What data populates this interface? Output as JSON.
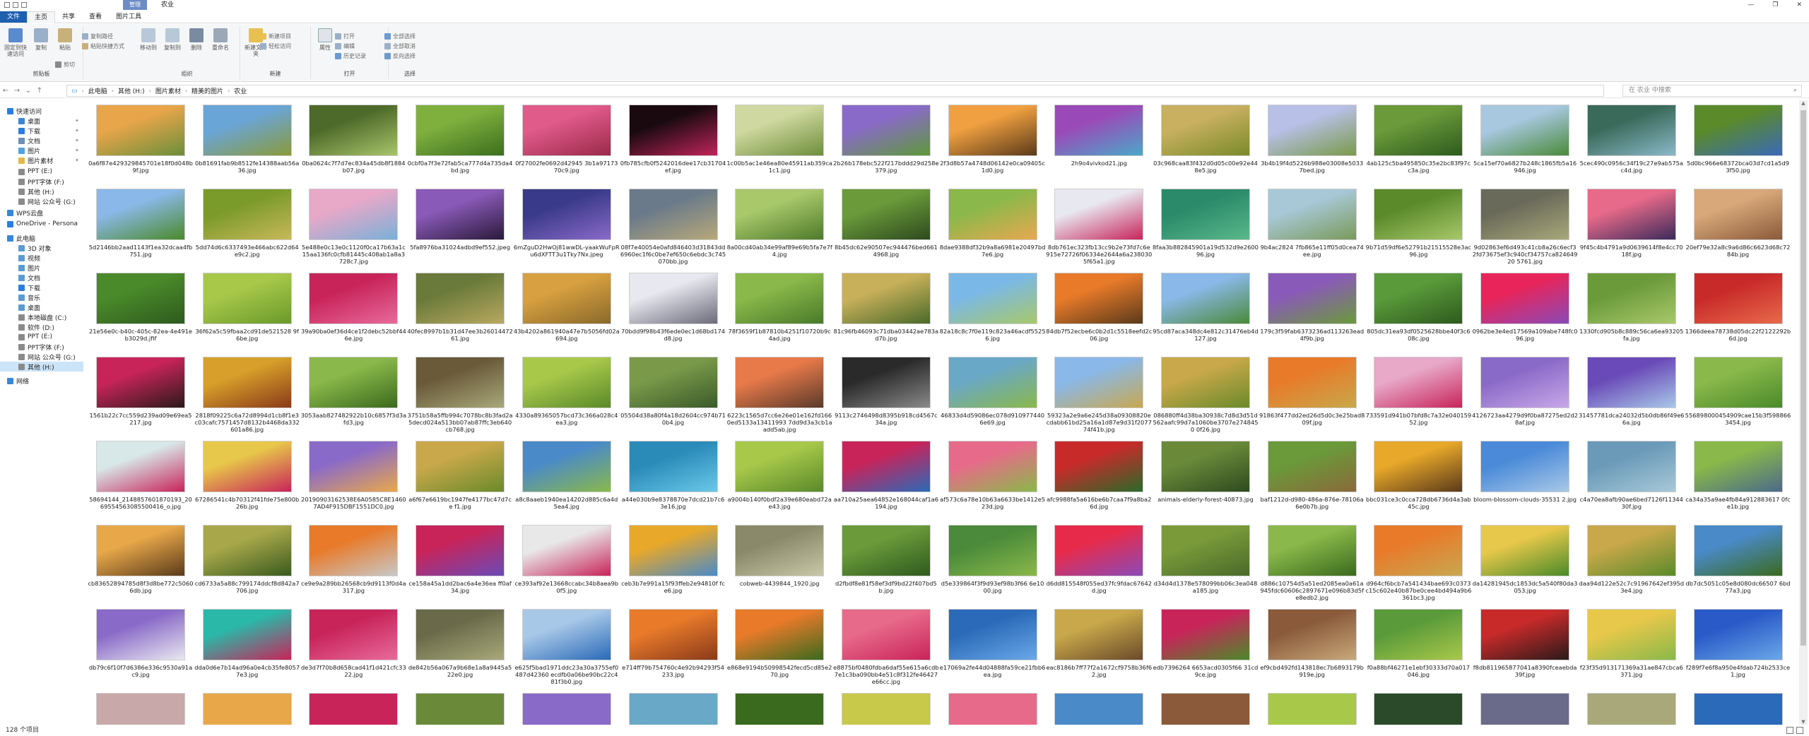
{
  "window": {
    "title": "农业",
    "context_tab": "管理",
    "controls": [
      "—",
      "❐",
      "✕"
    ]
  },
  "ribbon_tabs": [
    {
      "label": "文件",
      "kind": "file"
    },
    {
      "label": "主页",
      "kind": "active"
    },
    {
      "label": "共享",
      "kind": "normal"
    },
    {
      "label": "查看",
      "kind": "normal"
    },
    {
      "label": "图片工具",
      "kind": "normal"
    }
  ],
  "ribbon": {
    "clipboard": {
      "label": "剪贴板",
      "pin": "固定到快速访问",
      "copy": "复制",
      "paste": "粘贴",
      "copy_path": "复制路径",
      "paste_shortcut": "粘贴快捷方式",
      "cut": "剪切"
    },
    "organize": {
      "label": "组织",
      "move_to": "移动到",
      "copy_to": "复制到",
      "delete": "删除",
      "rename": "重命名"
    },
    "new": {
      "label": "新建",
      "new_folder": "新建文件夹",
      "new_item": "新建项目",
      "easy_access": "轻松访问"
    },
    "open": {
      "label": "打开",
      "properties": "属性",
      "open": "打开",
      "edit": "编辑",
      "history": "历史记录"
    },
    "select": {
      "label": "选择",
      "select_all": "全部选择",
      "select_none": "全部取消",
      "invert": "反向选择"
    }
  },
  "address": {
    "crumbs": [
      "此电脑",
      "其他 (H:)",
      "图片素材",
      "精美的图片",
      "农业"
    ],
    "search_placeholder": "在 农业 中搜索"
  },
  "nav": [
    {
      "label": "快速访问",
      "indent": 0,
      "color": "#2b7de1"
    },
    {
      "label": "桌面",
      "indent": 1,
      "color": "#3a86d6",
      "pin": true
    },
    {
      "label": "下载",
      "indent": 1,
      "color": "#2b7de1",
      "pin": true
    },
    {
      "label": "文档",
      "indent": 1,
      "color": "#6d8fb8",
      "pin": true
    },
    {
      "label": "图片",
      "indent": 1,
      "color": "#4ea3e0",
      "pin": true
    },
    {
      "label": "图片素材",
      "indent": 1,
      "color": "#e6b84a",
      "pin": true
    },
    {
      "label": "PPT (E:)",
      "indent": 1,
      "color": "#8a8a8a"
    },
    {
      "label": "PPT字体 (F:)",
      "indent": 1,
      "color": "#8a8a8a"
    },
    {
      "label": "其他 (H:)",
      "indent": 1,
      "color": "#8a8a8a"
    },
    {
      "label": "网站 公众号 (G:)",
      "indent": 1,
      "color": "#8a8a8a"
    },
    {
      "label": "WPS云盘",
      "indent": 0,
      "color": "#3a86d6"
    },
    {
      "label": "OneDrive - Persona",
      "indent": 0,
      "color": "#2b7de1"
    },
    {
      "label": "此电脑",
      "indent": 0,
      "color": "#3a86d6"
    },
    {
      "label": "3D 对象",
      "indent": 1,
      "color": "#5b9bd5"
    },
    {
      "label": "视频",
      "indent": 1,
      "color": "#5b9bd5"
    },
    {
      "label": "图片",
      "indent": 1,
      "color": "#5b9bd5"
    },
    {
      "label": "文档",
      "indent": 1,
      "color": "#5b9bd5"
    },
    {
      "label": "下载",
      "indent": 1,
      "color": "#2b7de1"
    },
    {
      "label": "音乐",
      "indent": 1,
      "color": "#5b9bd5"
    },
    {
      "label": "桌面",
      "indent": 1,
      "color": "#5b9bd5"
    },
    {
      "label": "本地磁盘 (C:)",
      "indent": 1,
      "color": "#8a8a8a"
    },
    {
      "label": "软件 (D:)",
      "indent": 1,
      "color": "#8a8a8a"
    },
    {
      "label": "PPT (E:)",
      "indent": 1,
      "color": "#8a8a8a"
    },
    {
      "label": "PPT字体 (F:)",
      "indent": 1,
      "color": "#8a8a8a"
    },
    {
      "label": "网站 公众号 (G:)",
      "indent": 1,
      "color": "#8a8a8a"
    },
    {
      "label": "其他 (H:)",
      "indent": 1,
      "color": "#8a8a8a",
      "selected": true
    },
    {
      "label": "网络",
      "indent": 0,
      "color": "#3a86d6"
    }
  ],
  "files": [
    {
      "name": "0a6f87e429329845701e18f0d048b9f.jpg",
      "colors": [
        "#e9a54a",
        "#6a8f3a"
      ]
    },
    {
      "name": "0b81691fab9b8512fe14388aab56a36.jpg",
      "colors": [
        "#6aa5d8",
        "#8a9a3a"
      ]
    },
    {
      "name": "0ba0624c7f7d7ec834a45db8f1884b07.jpg",
      "colors": [
        "#4e6a2a",
        "#a7c46a"
      ]
    },
    {
      "name": "0cbf0a7f3e72fab5ca777d4a735da4bd.jpg",
      "colors": [
        "#7fb03e",
        "#3d6e1e"
      ]
    },
    {
      "name": "0f27002fe0692d42945 3b1a9717370c9.jpg",
      "colors": [
        "#e05a8a",
        "#9a2a4a"
      ]
    },
    {
      "name": "0fb785cfb0f5242016dee17cb31704ef.jpg",
      "colors": [
        "#1a0a10",
        "#c0245a"
      ]
    },
    {
      "name": "1c00b5ac1e46ea80e45911ab359ca1c1.jpg",
      "colors": [
        "#cfd8a0",
        "#6e8e3a"
      ]
    },
    {
      "name": "2b26b178ebc522f217bddd29d258e379.jpg",
      "colors": [
        "#8a6ac8",
        "#5e9a3a"
      ]
    },
    {
      "name": "2f3d8b57a4748d06142e0ca09405c1d0.jpg",
      "colors": [
        "#f0a040",
        "#5a3a1a"
      ]
    },
    {
      "name": "2h9o4vivkod21.jpg",
      "colors": [
        "#9a4ab8",
        "#4aa8c8"
      ]
    },
    {
      "name": "03c968caa83f432d0d05c00e92e448e5.jpg",
      "colors": [
        "#c8b060",
        "#7a8a2a"
      ]
    },
    {
      "name": "3b4b19f4d5226b988e03008e50337bed.jpg",
      "colors": [
        "#b8c0e8",
        "#7a9a4a"
      ]
    },
    {
      "name": "4ab125c5ba495850c35e2bc83f97cc3a.jpg",
      "colors": [
        "#6a9a3a",
        "#2e5a1e"
      ]
    },
    {
      "name": "5ca15ef70a6827b248c1865fb5a16946.jpg",
      "colors": [
        "#a8c8e0",
        "#4a8a3a"
      ]
    },
    {
      "name": "5cec490c0956c34f19c27e9ab575ac4d.jpg",
      "colors": [
        "#3a6a5a",
        "#8ab8c8"
      ]
    },
    {
      "name": "5d0bc966e68372bca03d7cd1a5d93f50.jpg",
      "colors": [
        "#5a8a2a",
        "#3a6ab8"
      ]
    },
    {
      "name": "5d2146bb2aad1143f1ea32dcaa4fb751.jpg",
      "colors": [
        "#8ab8e8",
        "#4a8a2a"
      ]
    },
    {
      "name": "5dd74d6c6337493e466abc622d64e9c2.jpg",
      "colors": [
        "#7a9a2a",
        "#c8b85a"
      ]
    },
    {
      "name": "5e488e0c13e0c1120f0ca17b63a1c15aa136fc0cfb81445c408ab1a8a3728c7.jpg",
      "colors": [
        "#e8a8c8",
        "#7ab0d8"
      ]
    },
    {
      "name": "5fa8976ba31024adbd9ef552.jpeg",
      "colors": [
        "#8a5ab8",
        "#2a1a3a"
      ]
    },
    {
      "name": "6mZguD2HwOj81wwDL-yaakWuFpRu6dXFTT3u1Tky7Nx.jpeg",
      "colors": [
        "#3a3a8a",
        "#8a6ac8"
      ]
    },
    {
      "name": "08f7e40054e0afd846403d31843dd6960ec1f6c0be7ef650c6ebdc3c745070bb.jpg",
      "colors": [
        "#6a7a8a",
        "#b8a87a"
      ]
    },
    {
      "name": "8a00cd40ab34e99af89e69b5fa7e7f4.jpg",
      "colors": [
        "#a8c86a",
        "#4e7a2a"
      ]
    },
    {
      "name": "8b45dc62e90507ec944476bed6614968.jpg",
      "colors": [
        "#6a9a3a",
        "#2e4a1e"
      ]
    },
    {
      "name": "8dae9388df32b9a8a6981e20497bd7e6.jpg",
      "colors": [
        "#8ab84a",
        "#e8a850"
      ]
    },
    {
      "name": "8db761ec323fb13cc9b2e73fd7c6e915e72726f06334e2644a6a2380305f65a1.jpg",
      "colors": [
        "#e8e8f0",
        "#c8245a"
      ]
    },
    {
      "name": "8faa3b882845901a19d532d9e260096.jpg",
      "colors": [
        "#2a8a6a",
        "#5ab88a"
      ]
    },
    {
      "name": "9b4ac2824 7fb865e11ff05d0cea74ee.jpg",
      "colors": [
        "#a8c8d8",
        "#7a9a5a"
      ]
    },
    {
      "name": "9b71d59df6e52791b21515528e3ac96.jpg",
      "colors": [
        "#5a8a2a",
        "#a8c86a"
      ]
    },
    {
      "name": "9d02863ef6d493c41cb8a26c6ecf32fd73675ef3c940cf34757ca82464920 5761.jpg",
      "colors": [
        "#6a6a5a",
        "#a8a87a"
      ]
    },
    {
      "name": "9f45c4b4791a9d0639614f8e4cc7018f.jpg",
      "colors": [
        "#e86a8a",
        "#3a2a5a"
      ]
    },
    {
      "name": "20ef79e32a8c9a6d86c6623d68c7284b.jpg",
      "colors": [
        "#d8a87a",
        "#8a5a3a"
      ]
    },
    {
      "name": "21e56e0c-b40c-405c-82ea-4e491eb3029d.jfif",
      "colors": [
        "#4a8a2a",
        "#2e5a1e"
      ]
    },
    {
      "name": "36f62a5c59fbaa2cd91de521528 9f6be.jpg",
      "colors": [
        "#a8c84a",
        "#6a9a2a"
      ]
    },
    {
      "name": "39a90ba0ef36d4ce1f2debc52bbf446e.jpg",
      "colors": [
        "#c8245a",
        "#e86a9a"
      ]
    },
    {
      "name": "40fec8997b1b31d47ee3b2601447261.jpg",
      "colors": [
        "#6a7a3a",
        "#b8a860"
      ]
    },
    {
      "name": "43b4202a861940a47e7b5056fd02a694.jpg",
      "colors": [
        "#d8a040",
        "#8a6a2a"
      ]
    },
    {
      "name": "70bdd9f98b43f6ede0ec1d68bd174d8.jpg",
      "colors": [
        "#e8e8f0",
        "#6a6a7a"
      ]
    },
    {
      "name": "78f3659f1b87810b4251f10720b9c4ad.jpg",
      "colors": [
        "#8ab84a",
        "#4a7a2a"
      ]
    },
    {
      "name": "81c96fb46093c71dba03442ae783ad7b.jpg",
      "colors": [
        "#c8b05a",
        "#4a6a2a"
      ]
    },
    {
      "name": "82a18c8c7f0e119c823a46acdf55256.jpg",
      "colors": [
        "#7ab8e8",
        "#a8c86a"
      ]
    },
    {
      "name": "84db7f52ecbe6c0b2d1c5518eefd2c06.jpg",
      "colors": [
        "#e87a2a",
        "#5a3a1a"
      ]
    },
    {
      "name": "95cd87aca348dc4e812c31476eb4d127.jpg",
      "colors": [
        "#8ab8e8",
        "#4a8a3a"
      ]
    },
    {
      "name": "179c3f59fab6373236ad113263ead4f9b.jpg",
      "colors": [
        "#8a5ab8",
        "#6a9a3a"
      ]
    },
    {
      "name": "805dc31ea93df0525628bbe40f3c608c.jpg",
      "colors": [
        "#5a9a3a",
        "#2e5a1e"
      ]
    },
    {
      "name": "0962be3e4ed17569a109abe748fc096.jpg",
      "colors": [
        "#e8245a",
        "#8a4ab8"
      ]
    },
    {
      "name": "1330fcd905b8c889c56ca6ea93205fa.jpg",
      "colors": [
        "#6a9a3a",
        "#a8c86a"
      ]
    },
    {
      "name": "1366deea78738d05dc22f2122292b6d.jpg",
      "colors": [
        "#c82a2a",
        "#e86a4a"
      ]
    },
    {
      "name": "1561b22c7cc559d239ad09e69ea5217.jpg",
      "colors": [
        "#c8245a",
        "#2a1a1a"
      ]
    },
    {
      "name": "2818f09225c6a72d8994d1cb8f1e3c03cafc7571457d8132b4468da332601a86.jpg",
      "colors": [
        "#d8a02a",
        "#8a3a1a"
      ]
    },
    {
      "name": "3053aab827482922b10c6857f3d3afd3.jpg",
      "colors": [
        "#8ab84a",
        "#3a6a1e"
      ]
    },
    {
      "name": "3751b58a5ffb994c7078bc8b3fad2a5decd024a513bb07ab87ffc3eb640cb768.jpg",
      "colors": [
        "#6a5a3a",
        "#a8a87a"
      ]
    },
    {
      "name": "4330a89365057bcd73c366a028c4ea3.jpg",
      "colors": [
        "#a8c84a",
        "#5a8a2a"
      ]
    },
    {
      "name": "05504d38a80f4a18d2604cc974b710b4.jpg",
      "colors": [
        "#7a9a4a",
        "#3a5a2a"
      ]
    },
    {
      "name": "6223c1565d7cc6e26e01e162fd1660ed5133a13411993 7dd9d3a3cb1aadd5ab.jpg",
      "colors": [
        "#e87a4a",
        "#5a3a2a"
      ]
    },
    {
      "name": "9113c2746498d8395b918cd4567c34a.jpg",
      "colors": [
        "#2a2a2a",
        "#8a8a8a"
      ]
    },
    {
      "name": "46833d4d59086ec078d910977440 6e69.jpg",
      "colors": [
        "#6aa8c8",
        "#8ab84a"
      ]
    },
    {
      "name": "59323a2e9a6e245d38a09308820ecdabb61bd25a16a1d87e9d31f207774f41b.jpg",
      "colors": [
        "#8ab8e8",
        "#c8a850"
      ]
    },
    {
      "name": "086880ff4d38ba30938c7d8d3d51d562aafc99d7a1060be3707e2748450 0f26.jpg",
      "colors": [
        "#c8a84a",
        "#6a8a2a"
      ]
    },
    {
      "name": "91863f477dd2ed26d5d0c3e25bad809f.jpg",
      "colors": [
        "#e87a2a",
        "#c8a84a"
      ]
    },
    {
      "name": "733591d941b07bfd8c7a32e04015952.jpg",
      "colors": [
        "#e8a8c8",
        "#c8245a"
      ]
    },
    {
      "name": "4126723aa4279d9f0ba87275ed2d28af.jpg",
      "colors": [
        "#8a6ac8",
        "#c8a8e8"
      ]
    },
    {
      "name": "31457781dca24032d5b0db86f49e66a.jpg",
      "colors": [
        "#6a4ab8",
        "#a8c8e8"
      ]
    },
    {
      "name": "556898000454909cae15b3f5988663454.jpg",
      "colors": [
        "#8ab84a",
        "#4a8a2a"
      ]
    },
    {
      "name": "58694144_2148857601870193_2069554563085500416_o.jpg",
      "colors": [
        "#d8e8e8",
        "#c8245a"
      ]
    },
    {
      "name": "67286541c4b70312f41fde75e800b26b.jpg",
      "colors": [
        "#e8c84a",
        "#c8245a"
      ]
    },
    {
      "name": "20190903162538E6A0585C8E14607AD4F915DBF1551DC0.jpg",
      "colors": [
        "#8a6ac8",
        "#e8a84a"
      ]
    },
    {
      "name": "a6f67e6619bc1947fe4177bc47d7ce f1.jpg",
      "colors": [
        "#c8a84a",
        "#6a8a2a"
      ]
    },
    {
      "name": "a8c8aaeb1940ea14202d885c6a4d5ea4.jpg",
      "colors": [
        "#4a8ac8",
        "#8ab84a"
      ]
    },
    {
      "name": "a44e030b9e8378870e7dcd21b7c63e16.jpg",
      "colors": [
        "#2a8ab8",
        "#6ac8e8"
      ]
    },
    {
      "name": "a9004b140f0bdf2a39e680eabd72ae43.jpg",
      "colors": [
        "#a8c84a",
        "#5a8a2a"
      ]
    },
    {
      "name": "aa710a25aea64852e168044caf1a6194.jpg",
      "colors": [
        "#c8245a",
        "#2a6ab8"
      ]
    },
    {
      "name": "af573c6a78e10b63a6633be1412e5 23d.jpg",
      "colors": [
        "#e86a8a",
        "#8ab84a"
      ]
    },
    {
      "name": "afc9988fa5a616be6b7caa7f9a8ba26d.jpg",
      "colors": [
        "#c82a2a",
        "#2a6a2a"
      ]
    },
    {
      "name": "animals-elderly-forest-40873.jpg",
      "colors": [
        "#6a8a3a",
        "#2e4a1e"
      ]
    },
    {
      "name": "baf1212d-d980-486a-876e-78106a6e0b7b.jpg",
      "colors": [
        "#6a9a3a",
        "#8a6a3a"
      ]
    },
    {
      "name": "bbc031ce3c0cca728db6736d4a3ab45c.jpg",
      "colors": [
        "#e8a82a",
        "#5a3a1a"
      ]
    },
    {
      "name": "bloom-blossom-clouds-35531 2.jpg",
      "colors": [
        "#4a8ad8",
        "#a8c8e8"
      ]
    },
    {
      "name": "c4a70ea8afb90ae6bed7126f1134430f.jpg",
      "colors": [
        "#6a9ab8",
        "#a8c8d8"
      ]
    },
    {
      "name": "ca34a35a9ae4fb84a912883617 0fce1b.jpg",
      "colors": [
        "#8ab84a",
        "#4a6a8a"
      ]
    },
    {
      "name": "cb83652894785d8f3d8be772c50606db.jpg",
      "colors": [
        "#e8a84a",
        "#5a3a1a"
      ]
    },
    {
      "name": "cd6733a5a88c799174ddcf8d842a7706.jpg",
      "colors": [
        "#a8a84a",
        "#3a5a1e"
      ]
    },
    {
      "name": "ce9e9a289bb26568cb9d9113f0d4a317.jpg",
      "colors": [
        "#e87a2a",
        "#c8c8c8"
      ]
    },
    {
      "name": "ce158a45a1dd2bac6a4e36ea ff0af34.jpg",
      "colors": [
        "#c8245a",
        "#6a4ab8"
      ]
    },
    {
      "name": "ce393af92e13668ccabc34b8aea9b0f5.jpg",
      "colors": [
        "#e8e8e8",
        "#c8245a"
      ]
    },
    {
      "name": "ceb3b7e991a15f93ffeb2e94810f fce6.jpg",
      "colors": [
        "#e8a82a",
        "#4a8ac8"
      ]
    },
    {
      "name": "cobweb-4439844_1920.jpg",
      "colors": [
        "#8a8a6a",
        "#c8c8a8"
      ]
    },
    {
      "name": "d2fbdf8e81f58ef3df9bd22f407bd5b.jpg",
      "colors": [
        "#6a9a3a",
        "#2e5a1e"
      ]
    },
    {
      "name": "d5e339864f3f9d93ef98b3f66 6e1000.jpg",
      "colors": [
        "#4a8a3a",
        "#8ab84a"
      ]
    },
    {
      "name": "d6dd815548f055ed37fc9fdac67642d.jpg",
      "colors": [
        "#e82a4a",
        "#8a4ab8"
      ]
    },
    {
      "name": "d34d4d1378e578099bb06c3ea048a185.jpg",
      "colors": [
        "#7a9a3a",
        "#4a6a2a"
      ]
    },
    {
      "name": "d886c10754d5a51ed2085ea0a61a945fdc60606c2897671e096b83d5fe8edb2.jpg",
      "colors": [
        "#8ab84a",
        "#3a6a1e"
      ]
    },
    {
      "name": "d964cf6bcb7a541434bae693c0373c15c602e40b87be0cee4bd494a9b6361bc3.jpg",
      "colors": [
        "#e87a2a",
        "#c8a850"
      ]
    },
    {
      "name": "da14281945dc1853dc5a540f80da3053.jpg",
      "colors": [
        "#e8c84a",
        "#4a8a2a"
      ]
    },
    {
      "name": "daa94d122e52c7c91967642ef395d3e4.jpg",
      "colors": [
        "#c8a84a",
        "#5a8a2a"
      ]
    },
    {
      "name": "db7dc5051c05e8d080dc66507 6bd77a3.jpg",
      "colors": [
        "#4a8ac8",
        "#3a6a1e"
      ]
    },
    {
      "name": "db79c6f10f7d6386e336c9530a91ac9.jpg",
      "colors": [
        "#8a6ac8",
        "#e8e8f0"
      ]
    },
    {
      "name": "dda0d6e7b14ad96a0e4cb35fe80577e3.jpg",
      "colors": [
        "#2ab8a8",
        "#c8245a"
      ]
    },
    {
      "name": "de3d7f70b8d658cad41f1d421cfc3322.jpg",
      "colors": [
        "#c8245a",
        "#e86a9a"
      ]
    },
    {
      "name": "de842b56a067a9b68e1a8a9445a522e0.jpg",
      "colors": [
        "#6a6a4a",
        "#a8a87a"
      ]
    },
    {
      "name": "e625f5bad1971ddc23a30a3755ef0487d42360 ecdfb0a06be90bc22c481f3b0.jpg",
      "colors": [
        "#a8c8e8",
        "#2a6ab8"
      ]
    },
    {
      "name": "e714ff79b754760c4e92b94293f54233.jpg",
      "colors": [
        "#e87a2a",
        "#8a3a1a"
      ]
    },
    {
      "name": "e868e9194b50998542fecd5cd85e270.jpg",
      "colors": [
        "#e87a2a",
        "#3a6a1e"
      ]
    },
    {
      "name": "e8875bf0480fdba6daf55e615a6cdb7e1c3ba090bb4e51c8f312fe46427e66cc.jpg",
      "colors": [
        "#e86a8a",
        "#c8245a"
      ]
    },
    {
      "name": "e17069a2fe44d04888fa59ce21fbb6ea.jpg",
      "colors": [
        "#2a6ab8",
        "#6aa8e8"
      ]
    },
    {
      "name": "eac8186b7ff77f2a1672cf9758b36f62.jpg",
      "colors": [
        "#c8a84a",
        "#6a4a2a"
      ]
    },
    {
      "name": "edb7396264 6653acd0305f66 31cd9ce.jpg",
      "colors": [
        "#c8245a",
        "#4a8a2a"
      ]
    },
    {
      "name": "ef9cbd492fd143818ec7b6893179b919e.jpg",
      "colors": [
        "#8a5a3a",
        "#c8a87a"
      ]
    },
    {
      "name": "f0a88bf46271e1ebf30333d70a017046.jpg",
      "colors": [
        "#5a9a3a",
        "#a8c84a"
      ]
    },
    {
      "name": "f8db811965877041a8390fceaebda39f.jpg",
      "colors": [
        "#c82a2a",
        "#2a1a1a"
      ]
    },
    {
      "name": "f23f35d913171369a31ae847cbca6371.jpg",
      "colors": [
        "#e8c84a",
        "#8ab84a"
      ]
    },
    {
      "name": "f289f7e6f8a950e4fdab724b2533ce1.jpg",
      "colors": [
        "#2a5ac8",
        "#6aa8e8"
      ]
    }
  ],
  "peek_colors": [
    "#c8a8a8",
    "#e8a84a",
    "#c8245a",
    "#6a8a3a",
    "#8a6ac8",
    "#6aa8c8",
    "#3a6a1e",
    "#c8c84a",
    "#e86a8a",
    "#4a8ac8",
    "#8a5a3a",
    "#a8c84a",
    "#2a4a2a",
    "#6a6a8a",
    "#a8a87a",
    "#2a6ab8"
  ],
  "status": {
    "count": "128 个项目"
  }
}
